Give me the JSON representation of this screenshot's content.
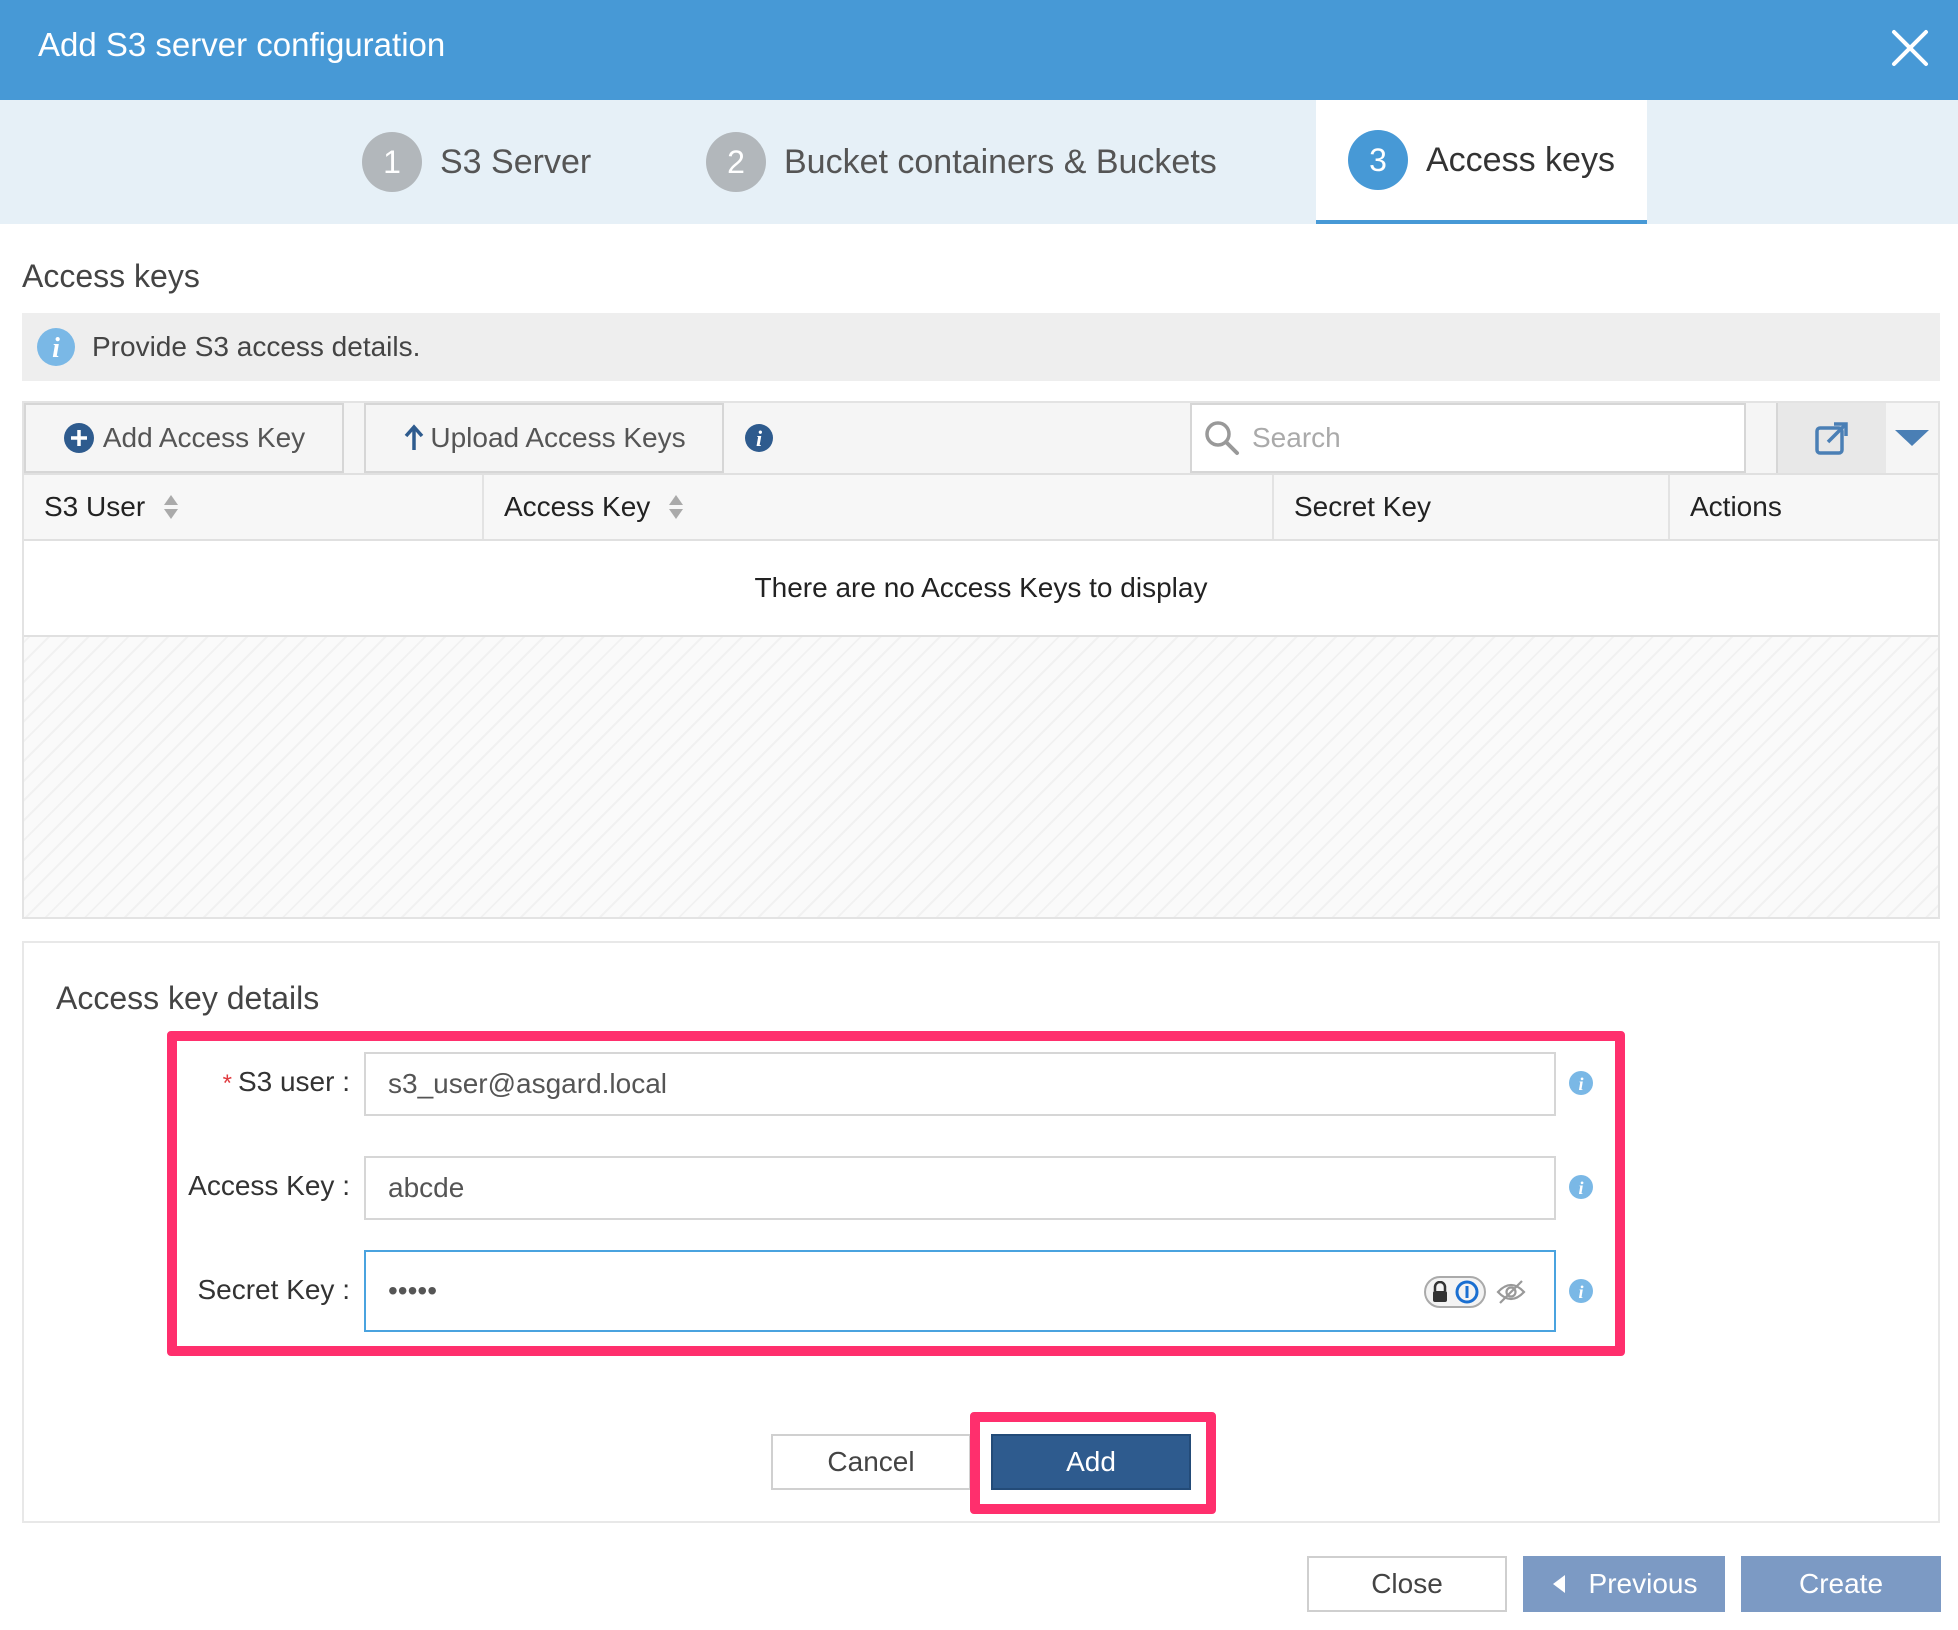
{
  "window": {
    "title": "Add S3 server configuration"
  },
  "steps": [
    {
      "number": "1",
      "label": "S3 Server"
    },
    {
      "number": "2",
      "label": "Bucket containers & Buckets"
    },
    {
      "number": "3",
      "label": "Access keys"
    }
  ],
  "access_keys": {
    "title": "Access keys",
    "info": "Provide S3 access details.",
    "toolbar": {
      "add_label": "Add Access Key",
      "upload_label": "Upload Access Keys",
      "search_placeholder": "Search"
    },
    "table": {
      "columns": [
        "S3 User",
        "Access Key",
        "Secret Key",
        "Actions"
      ],
      "empty_message": "There are no Access Keys to display"
    }
  },
  "details": {
    "title": "Access key details",
    "fields": {
      "s3_user": {
        "label": "S3 user",
        "value": "s3_user@asgard.local"
      },
      "access_key": {
        "label": "Access Key",
        "value": "abcde"
      },
      "secret_key": {
        "label": "Secret Key",
        "value": "•••••"
      }
    },
    "cancel_label": "Cancel",
    "add_label": "Add"
  },
  "footer": {
    "close_label": "Close",
    "previous_label": "Previous",
    "create_label": "Create"
  },
  "colors": {
    "header": "#4799d6",
    "primary_button": "#2e5b8e",
    "disabled_button": "#7c9ac4",
    "highlight": "#ff2f6d"
  }
}
